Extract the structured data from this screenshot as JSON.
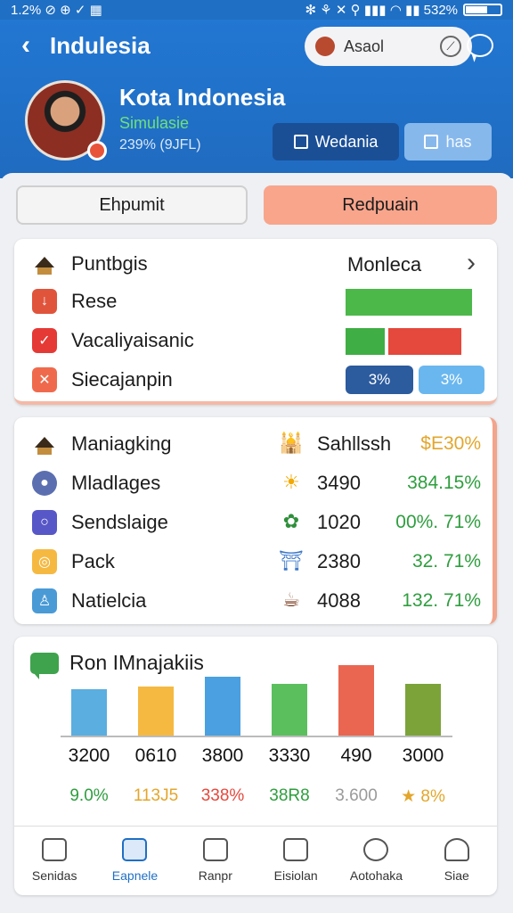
{
  "status_bar": {
    "left": "1.2% ⊘ ⊕ ✓ ▦",
    "right": "✻ ⚘ ✕ ⚲ ▮▮▮ ◠ ▮▮ 532%"
  },
  "header": {
    "back": "‹",
    "title": "Indulesia",
    "search_label": "Asaol",
    "search_go": "⟋",
    "profile": {
      "name": "Kota Indonesia",
      "subtitle": "Simulasie",
      "meta": "239% (9JFL)"
    },
    "buttons": {
      "primary": "Wedania",
      "secondary": "has"
    }
  },
  "tabs": {
    "left": "Ehpumit",
    "right": "Redpuain"
  },
  "card1": {
    "header_left": "Puntbgis",
    "header_right": "Monleca",
    "chevron": "›",
    "rows": [
      {
        "label": "Rese",
        "icon": "↓",
        "icon_color": "#e0543c"
      },
      {
        "label": "Vacaliyaisanic",
        "icon": "✓",
        "icon_color": "#e53935"
      },
      {
        "label": "Siecajanpin",
        "icon": "✕",
        "icon_color": "#ef6a4c"
      }
    ],
    "pill_left": "3%",
    "pill_right": "3%",
    "colors": {
      "green": "#4cb84a",
      "red": "#e5483c",
      "dark_blue": "#2c5b9e",
      "light_blue": "#6ab7ef"
    }
  },
  "card2": {
    "rows": [
      {
        "label": "Maniagking",
        "icon_left": "temple-icon",
        "right_icon": "🕌",
        "value": "Sahllssh",
        "pct": "$E30%",
        "pct_color": "#e3a62c"
      },
      {
        "label": "Mladlages",
        "icon_left": "person-icon",
        "right_icon": "☀",
        "value": "3490",
        "pct": "384.15%",
        "pct_color": "#2e9e3e"
      },
      {
        "label": "Sendslaige",
        "icon_left": "ring-icon",
        "right_icon": "✿",
        "value": "1020",
        "pct": "00%. 71%",
        "pct_color": "#2e9e3e"
      },
      {
        "label": "Pack",
        "icon_left": "target-icon",
        "right_icon": "⛩",
        "value": "2380",
        "pct": "32. 71%",
        "pct_color": "#2e9e3e"
      },
      {
        "label": "Natielcia",
        "icon_left": "user-icon",
        "right_icon": "☕",
        "value": "4088",
        "pct": "132. 71%",
        "pct_color": "#2e9e3e"
      }
    ]
  },
  "chart_data": {
    "type": "bar",
    "title": "Ron IMnajakiis",
    "categories": [
      "3200",
      "0610",
      "3800",
      "3330",
      "490",
      "3000"
    ],
    "values": [
      52,
      55,
      66,
      58,
      79,
      58
    ],
    "value_labels": [
      "3200",
      "0610",
      "3800",
      "3330",
      "490",
      "3000"
    ],
    "pct_labels": [
      "9.0%",
      "113J5",
      "338%",
      "38R8",
      "3.600",
      "★ 8%"
    ],
    "pct_colors": [
      "#2e9e3e",
      "#e3a62c",
      "#e5483c",
      "#2e9e3e",
      "#9a9a9a",
      "#e3a62c"
    ],
    "bar_colors": [
      "#5aaee0",
      "#f5b942",
      "#4aa0e0",
      "#5cbf5e",
      "#ea6650",
      "#7ba33a"
    ],
    "ylim": [
      0,
      100
    ]
  },
  "nav": [
    {
      "label": "Senidas",
      "icon": "home-icon",
      "active": false
    },
    {
      "label": "Eapnele",
      "icon": "edit-icon",
      "active": true
    },
    {
      "label": "Ranpr",
      "icon": "people-icon",
      "active": false
    },
    {
      "label": "Eisiolan",
      "icon": "board-icon",
      "active": false
    },
    {
      "label": "Aotohaka",
      "icon": "globe-icon",
      "active": false
    },
    {
      "label": "Siae",
      "icon": "person-icon",
      "active": false
    }
  ]
}
